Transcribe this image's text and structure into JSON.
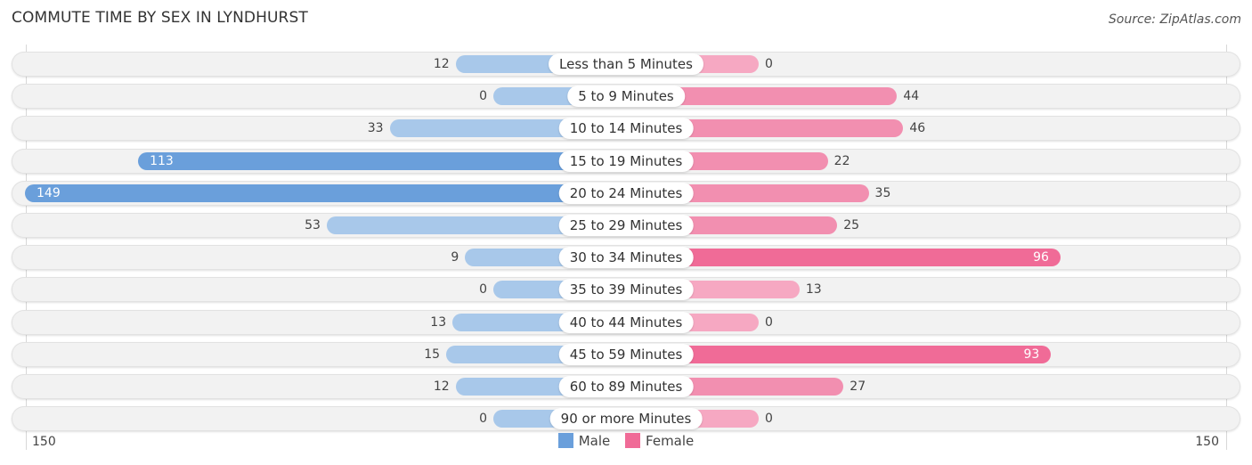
{
  "header": {
    "title": "COMMUTE TIME BY SEX IN LYNDHURST",
    "source": "Source: ZipAtlas.com"
  },
  "colors": {
    "male": "#6a9fdb",
    "male_light": "#a8c8ea",
    "female": "#f06b97",
    "female_light": "#f6a8c2"
  },
  "chart_data": {
    "type": "bar",
    "orientation": "horizontal-diverging",
    "title": "COMMUTE TIME BY SEX IN LYNDHURST",
    "categories": [
      "Less than 5 Minutes",
      "5 to 9 Minutes",
      "10 to 14 Minutes",
      "15 to 19 Minutes",
      "20 to 24 Minutes",
      "25 to 29 Minutes",
      "30 to 34 Minutes",
      "35 to 39 Minutes",
      "40 to 44 Minutes",
      "45 to 59 Minutes",
      "60 to 89 Minutes",
      "90 or more Minutes"
    ],
    "series": [
      {
        "name": "Male",
        "values": [
          12,
          0,
          33,
          113,
          149,
          53,
          9,
          0,
          13,
          15,
          12,
          0
        ]
      },
      {
        "name": "Female",
        "values": [
          0,
          44,
          46,
          22,
          35,
          25,
          96,
          13,
          0,
          93,
          27,
          0
        ]
      }
    ],
    "axis": {
      "left_label": "150",
      "right_label": "150",
      "max": 150
    },
    "legend": {
      "position": "bottom-center",
      "entries": [
        "Male",
        "Female"
      ]
    }
  }
}
